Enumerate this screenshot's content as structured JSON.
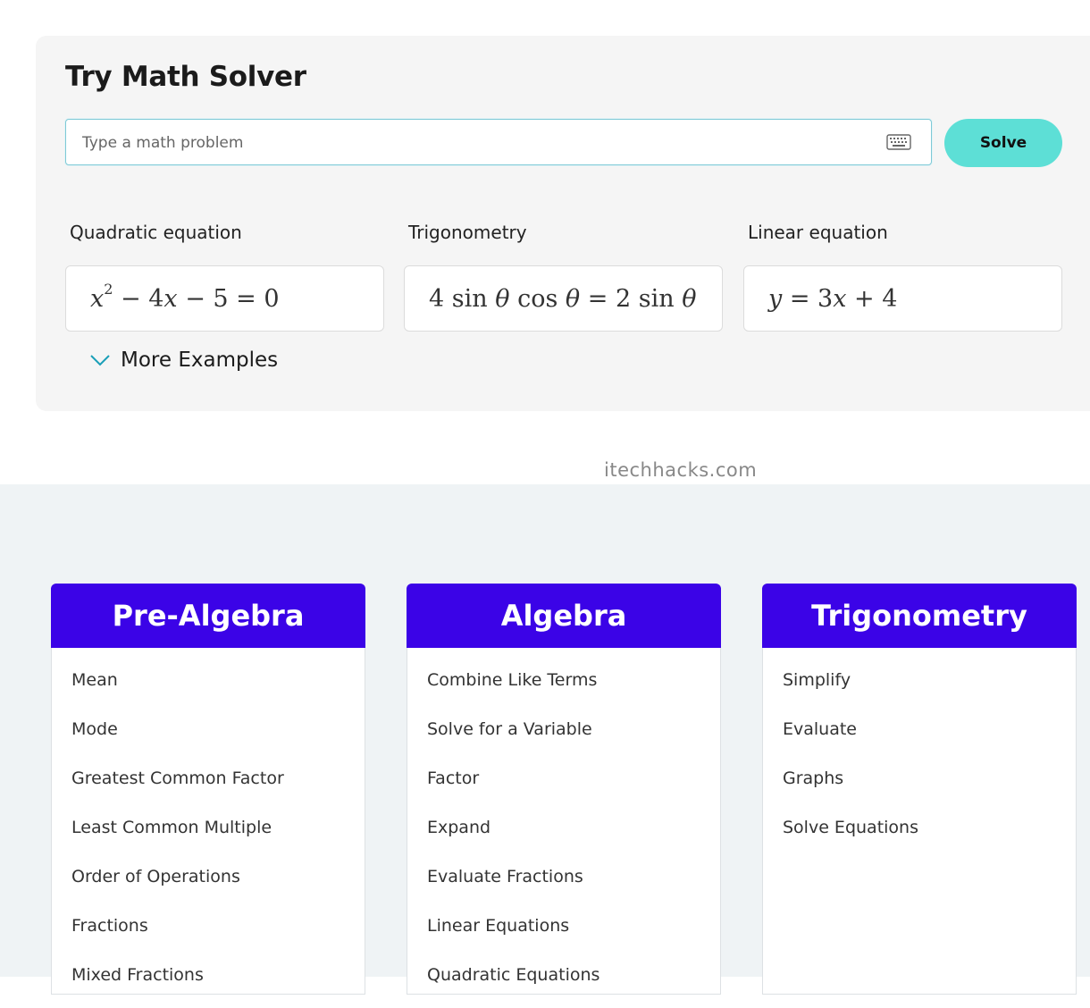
{
  "solver": {
    "title": "Try Math Solver",
    "input_placeholder": "Type a math problem",
    "input_value": "",
    "keyboard_icon": "keyboard-icon",
    "solve_label": "Solve",
    "examples": [
      {
        "label": "Quadratic equation"
      },
      {
        "label": "Trigonometry"
      },
      {
        "label": "Linear equation"
      }
    ],
    "more_examples_label": "More Examples"
  },
  "watermark": "itechhacks.com",
  "topics": [
    {
      "title": "Pre-Algebra",
      "items": [
        "Mean",
        "Mode",
        "Greatest Common Factor",
        "Least Common Multiple",
        "Order of Operations",
        "Fractions",
        "Mixed Fractions"
      ]
    },
    {
      "title": "Algebra",
      "items": [
        "Combine Like Terms",
        "Solve for a Variable",
        "Factor",
        "Expand",
        "Evaluate Fractions",
        "Linear Equations",
        "Quadratic Equations"
      ]
    },
    {
      "title": "Trigonometry",
      "items": [
        "Simplify",
        "Evaluate",
        "Graphs",
        "Solve Equations"
      ]
    }
  ],
  "colors": {
    "accent_solve": "#5ddfd6",
    "topic_header": "#3b03e7",
    "chevron": "#1a9fb8"
  }
}
